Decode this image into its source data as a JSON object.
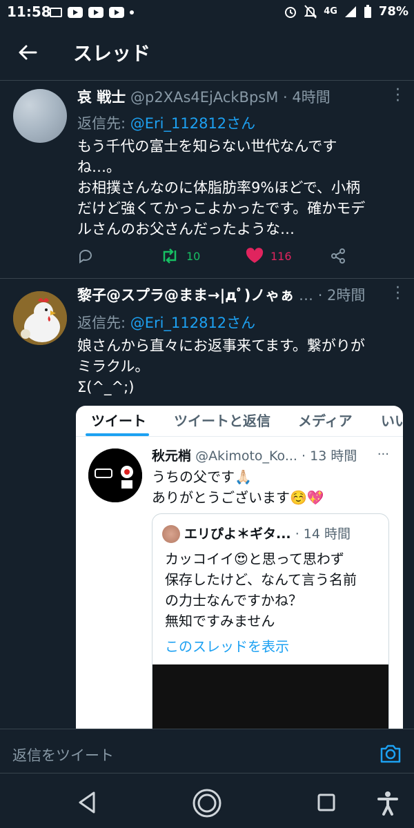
{
  "status_bar": {
    "time": "11:58",
    "network": "4G",
    "battery": "78%",
    "icons": [
      "tv-icon",
      "youtube-icon",
      "youtube-icon",
      "youtube-icon",
      "dot-icon",
      "alarm-icon",
      "mute-icon",
      "signal-icon",
      "battery-icon"
    ]
  },
  "header": {
    "title": "スレッド",
    "back_icon": "arrow-left-icon"
  },
  "tweets": [
    {
      "name": "哀 戦士",
      "handle": "@p2XAs4EjAckBpsM",
      "time": "· 4時間",
      "reply_label": "返信先: ",
      "reply_to": "@Eri_112812さん",
      "body": [
        "もう千代の富士を知らない世代なんです",
        "ね…。",
        "お相撲さんなのに体脂肪率9%ほどで、小柄",
        "だけど強くてかっこよかったです。確かモデ",
        "ルさんのお父さんだったような…"
      ],
      "retweets": "10",
      "likes": "116"
    },
    {
      "name": "黎子@スプラ@まま→|дﾟ)ノゃぁ",
      "ellipsis": "…",
      "time": "· 2時間",
      "reply_label": "返信先: ",
      "reply_to": "@Eri_112812さん",
      "body": [
        "娘さんから直々にお返事来てます。繋がりが",
        "ミラクル。",
        "Σ(^_^;)"
      ]
    }
  ],
  "embedded_screenshot": {
    "tabs": [
      "ツイート",
      "ツイートと返信",
      "メディア",
      "いい"
    ],
    "name": "秋元梢",
    "handle": "@Akimoto_Ko...",
    "time": "· 13 時間",
    "body": [
      "うちの父です🙏🏻",
      "ありがとうございます☺️💖"
    ],
    "quote": {
      "name": "エリぴよ＊ギタ...",
      "time": "· 14 時間",
      "body": [
        "カッコイイ😍と思って思わず",
        "保存したけど、なんて言う名前",
        "の力士なんですかね？",
        "無知ですみません"
      ],
      "link": "このスレッドを表示"
    }
  },
  "reply_bar": {
    "placeholder": "返信をツイート"
  },
  "colors": {
    "background": "#15202b",
    "link": "#1da1f2",
    "retweet": "#17bf63",
    "like": "#e0245e",
    "muted": "#8899a6"
  }
}
